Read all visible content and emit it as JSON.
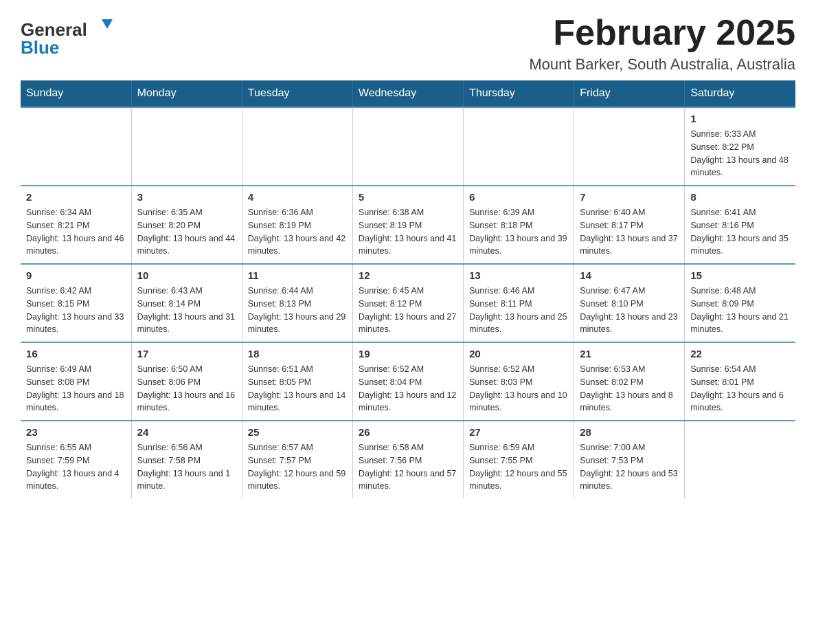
{
  "header": {
    "logo_general": "General",
    "logo_blue": "Blue",
    "title": "February 2025",
    "subtitle": "Mount Barker, South Australia, Australia"
  },
  "calendar": {
    "days_of_week": [
      "Sunday",
      "Monday",
      "Tuesday",
      "Wednesday",
      "Thursday",
      "Friday",
      "Saturday"
    ],
    "weeks": [
      [
        {
          "day": "",
          "info": ""
        },
        {
          "day": "",
          "info": ""
        },
        {
          "day": "",
          "info": ""
        },
        {
          "day": "",
          "info": ""
        },
        {
          "day": "",
          "info": ""
        },
        {
          "day": "",
          "info": ""
        },
        {
          "day": "1",
          "info": "Sunrise: 6:33 AM\nSunset: 8:22 PM\nDaylight: 13 hours and 48 minutes."
        }
      ],
      [
        {
          "day": "2",
          "info": "Sunrise: 6:34 AM\nSunset: 8:21 PM\nDaylight: 13 hours and 46 minutes."
        },
        {
          "day": "3",
          "info": "Sunrise: 6:35 AM\nSunset: 8:20 PM\nDaylight: 13 hours and 44 minutes."
        },
        {
          "day": "4",
          "info": "Sunrise: 6:36 AM\nSunset: 8:19 PM\nDaylight: 13 hours and 42 minutes."
        },
        {
          "day": "5",
          "info": "Sunrise: 6:38 AM\nSunset: 8:19 PM\nDaylight: 13 hours and 41 minutes."
        },
        {
          "day": "6",
          "info": "Sunrise: 6:39 AM\nSunset: 8:18 PM\nDaylight: 13 hours and 39 minutes."
        },
        {
          "day": "7",
          "info": "Sunrise: 6:40 AM\nSunset: 8:17 PM\nDaylight: 13 hours and 37 minutes."
        },
        {
          "day": "8",
          "info": "Sunrise: 6:41 AM\nSunset: 8:16 PM\nDaylight: 13 hours and 35 minutes."
        }
      ],
      [
        {
          "day": "9",
          "info": "Sunrise: 6:42 AM\nSunset: 8:15 PM\nDaylight: 13 hours and 33 minutes."
        },
        {
          "day": "10",
          "info": "Sunrise: 6:43 AM\nSunset: 8:14 PM\nDaylight: 13 hours and 31 minutes."
        },
        {
          "day": "11",
          "info": "Sunrise: 6:44 AM\nSunset: 8:13 PM\nDaylight: 13 hours and 29 minutes."
        },
        {
          "day": "12",
          "info": "Sunrise: 6:45 AM\nSunset: 8:12 PM\nDaylight: 13 hours and 27 minutes."
        },
        {
          "day": "13",
          "info": "Sunrise: 6:46 AM\nSunset: 8:11 PM\nDaylight: 13 hours and 25 minutes."
        },
        {
          "day": "14",
          "info": "Sunrise: 6:47 AM\nSunset: 8:10 PM\nDaylight: 13 hours and 23 minutes."
        },
        {
          "day": "15",
          "info": "Sunrise: 6:48 AM\nSunset: 8:09 PM\nDaylight: 13 hours and 21 minutes."
        }
      ],
      [
        {
          "day": "16",
          "info": "Sunrise: 6:49 AM\nSunset: 8:08 PM\nDaylight: 13 hours and 18 minutes."
        },
        {
          "day": "17",
          "info": "Sunrise: 6:50 AM\nSunset: 8:06 PM\nDaylight: 13 hours and 16 minutes."
        },
        {
          "day": "18",
          "info": "Sunrise: 6:51 AM\nSunset: 8:05 PM\nDaylight: 13 hours and 14 minutes."
        },
        {
          "day": "19",
          "info": "Sunrise: 6:52 AM\nSunset: 8:04 PM\nDaylight: 13 hours and 12 minutes."
        },
        {
          "day": "20",
          "info": "Sunrise: 6:52 AM\nSunset: 8:03 PM\nDaylight: 13 hours and 10 minutes."
        },
        {
          "day": "21",
          "info": "Sunrise: 6:53 AM\nSunset: 8:02 PM\nDaylight: 13 hours and 8 minutes."
        },
        {
          "day": "22",
          "info": "Sunrise: 6:54 AM\nSunset: 8:01 PM\nDaylight: 13 hours and 6 minutes."
        }
      ],
      [
        {
          "day": "23",
          "info": "Sunrise: 6:55 AM\nSunset: 7:59 PM\nDaylight: 13 hours and 4 minutes."
        },
        {
          "day": "24",
          "info": "Sunrise: 6:56 AM\nSunset: 7:58 PM\nDaylight: 13 hours and 1 minute."
        },
        {
          "day": "25",
          "info": "Sunrise: 6:57 AM\nSunset: 7:57 PM\nDaylight: 12 hours and 59 minutes."
        },
        {
          "day": "26",
          "info": "Sunrise: 6:58 AM\nSunset: 7:56 PM\nDaylight: 12 hours and 57 minutes."
        },
        {
          "day": "27",
          "info": "Sunrise: 6:59 AM\nSunset: 7:55 PM\nDaylight: 12 hours and 55 minutes."
        },
        {
          "day": "28",
          "info": "Sunrise: 7:00 AM\nSunset: 7:53 PM\nDaylight: 12 hours and 53 minutes."
        },
        {
          "day": "",
          "info": ""
        }
      ]
    ]
  }
}
